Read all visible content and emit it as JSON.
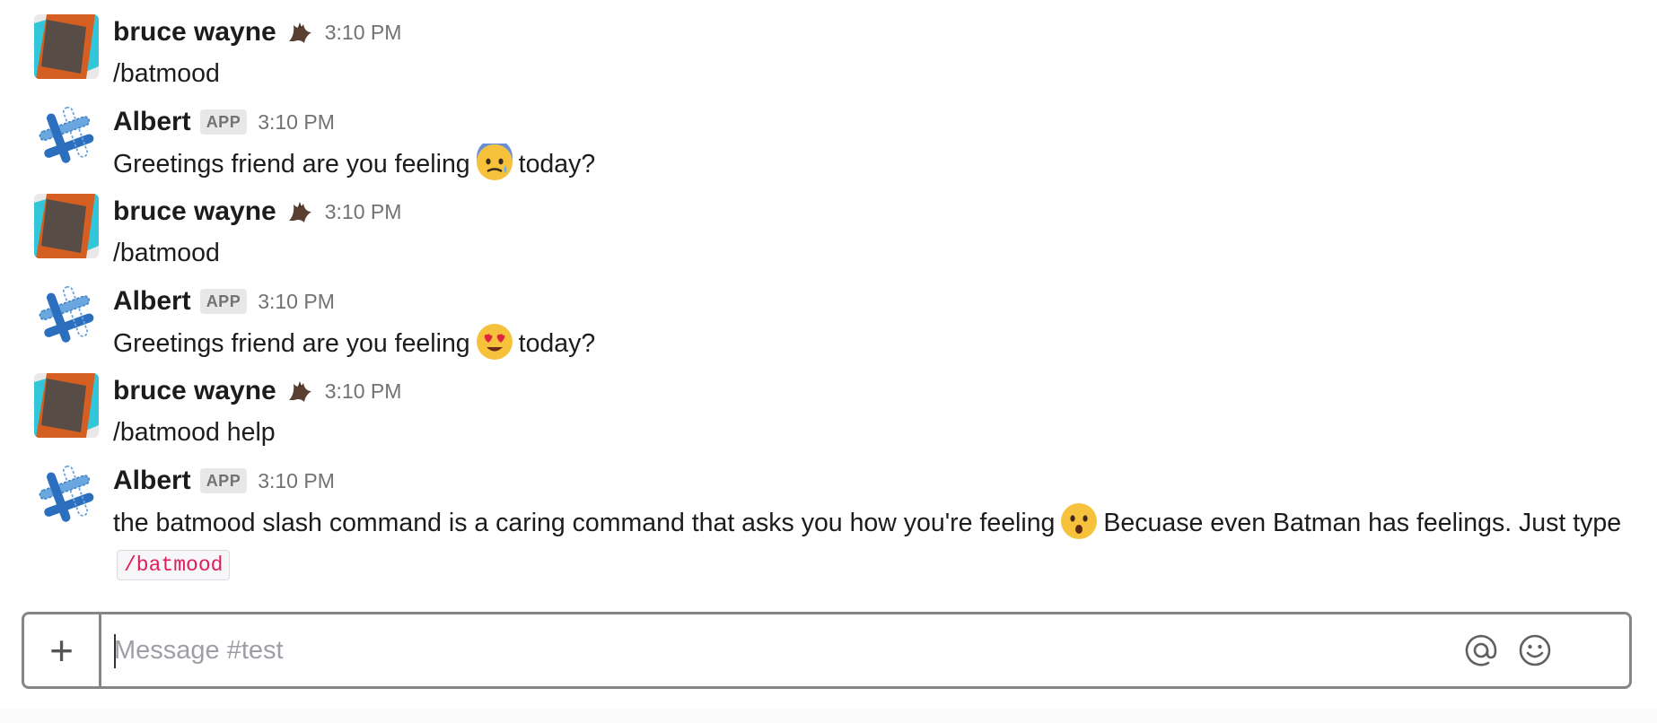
{
  "channel": "test",
  "colors": {
    "code_text": "#e01e5a",
    "timestamp": "#717274",
    "app_badge_bg": "#e8e8e8"
  },
  "messages": [
    {
      "sender": "bruce wayne",
      "status_icon": "bat-emoji",
      "is_app": false,
      "time": "3:10 PM",
      "text_before": "/batmood",
      "emoji": null,
      "text_after": ""
    },
    {
      "sender": "Albert",
      "is_app": true,
      "app_badge": "APP",
      "time": "3:10 PM",
      "text_before": "Greetings friend are you feeling",
      "emoji": "anxious-sweat-face",
      "text_after": "today?"
    },
    {
      "sender": "bruce wayne",
      "status_icon": "bat-emoji",
      "is_app": false,
      "time": "3:10 PM",
      "text_before": "/batmood",
      "emoji": null,
      "text_after": ""
    },
    {
      "sender": "Albert",
      "is_app": true,
      "app_badge": "APP",
      "time": "3:10 PM",
      "text_before": "Greetings friend are you feeling",
      "emoji": "heart-eyes-face",
      "text_after": "today?"
    },
    {
      "sender": "bruce wayne",
      "status_icon": "bat-emoji",
      "is_app": false,
      "time": "3:10 PM",
      "text_before": "/batmood help",
      "emoji": null,
      "text_after": ""
    },
    {
      "sender": "Albert",
      "is_app": true,
      "app_badge": "APP",
      "time": "3:10 PM",
      "text_before": "the batmood slash command is a caring command that asks you how you're feeling",
      "emoji": "hushed-face",
      "text_after": "Becuase even Batman has feelings. Just type",
      "code": "/batmood"
    }
  ],
  "composer": {
    "placeholder": "Message #test",
    "value": "",
    "add_icon": "plus-icon",
    "mention_icon": "at-sign-icon",
    "emoji_icon": "smiley-icon"
  }
}
